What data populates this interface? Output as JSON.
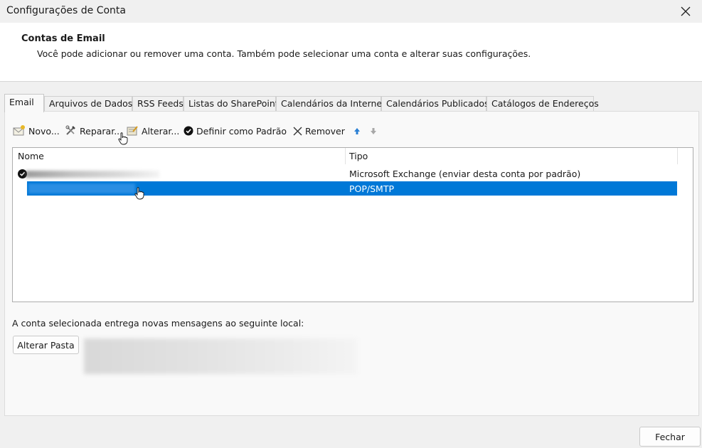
{
  "window": {
    "title": "Configurações de Conta"
  },
  "header": {
    "title": "Contas de Email",
    "description": "Você pode adicionar ou remover uma conta. Também pode selecionar uma conta e alterar suas configurações."
  },
  "tabs": [
    {
      "label": "Email",
      "active": true
    },
    {
      "label": "Arquivos de Dados"
    },
    {
      "label": "RSS Feeds"
    },
    {
      "label": "Listas do SharePoint"
    },
    {
      "label": "Calendários da Internet"
    },
    {
      "label": "Calendários Publicados"
    },
    {
      "label": "Catálogos de Endereços"
    }
  ],
  "toolbar": {
    "new_label": "Novo...",
    "repair_label": "Reparar...",
    "change_label": "Alterar...",
    "default_label": "Definir como Padrão",
    "remove_label": "Remover"
  },
  "list": {
    "columns": {
      "name": "Nome",
      "type": "Tipo"
    },
    "rows": [
      {
        "name": "",
        "type": "Microsoft Exchange (enviar desta conta por padrão)",
        "default": true,
        "selected": false
      },
      {
        "name": "",
        "type": "POP/SMTP",
        "default": false,
        "selected": true
      }
    ]
  },
  "delivery": {
    "label": "A conta selecionada entrega novas mensagens ao seguinte local:",
    "change_folder_label": "Alterar Pasta"
  },
  "footer": {
    "close_label": "Fechar"
  },
  "colors": {
    "selection": "#0078d7",
    "accent_arrow": "#2a7fd4"
  }
}
